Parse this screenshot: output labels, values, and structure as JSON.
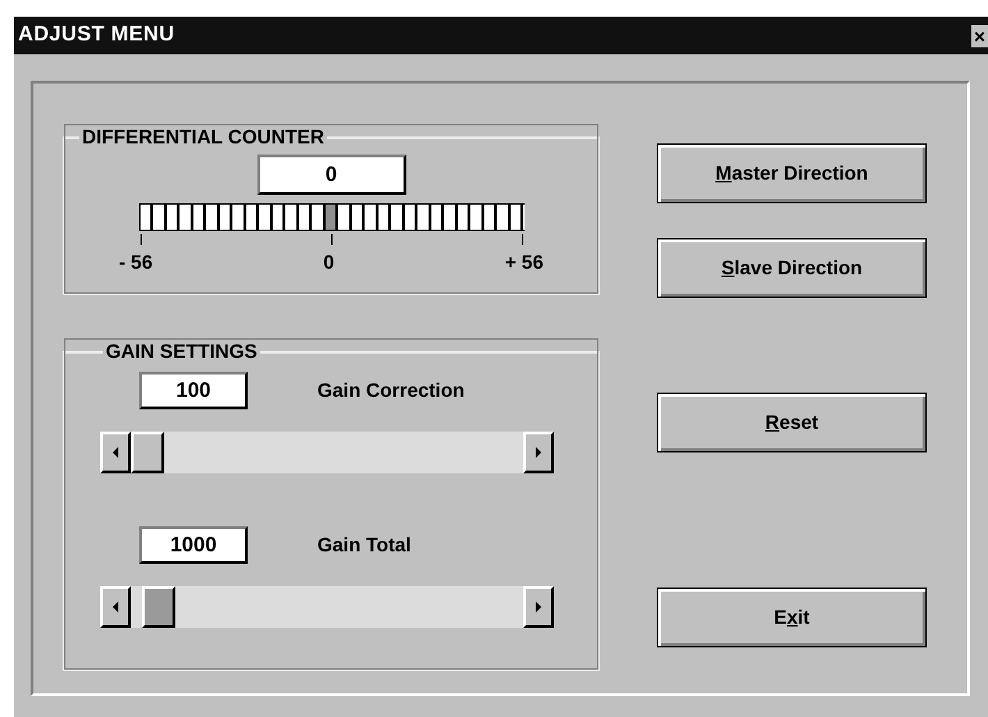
{
  "window": {
    "title": "ADJUST MENU",
    "close_glyph": "×"
  },
  "differential_counter": {
    "title": "DIFFERENTIAL COUNTER",
    "value": "0",
    "level": 0.5,
    "scale_labels": [
      "- 56",
      "0",
      "+ 56"
    ]
  },
  "gain_settings": {
    "title": "GAIN SETTINGS",
    "items": [
      {
        "value": "100",
        "label": "Gain Correction",
        "level": 0.0,
        "focused": false
      },
      {
        "value": "1000",
        "label": "Gain Total",
        "level": 0.03,
        "focused": true
      }
    ]
  },
  "buttons": [
    {
      "key": "M",
      "after": "aster Direction"
    },
    {
      "key": "S",
      "after": "lave Direction"
    },
    {
      "key": "R",
      "after": "eset"
    },
    {
      "before": "E",
      "key": "x",
      "after": "it"
    }
  ]
}
